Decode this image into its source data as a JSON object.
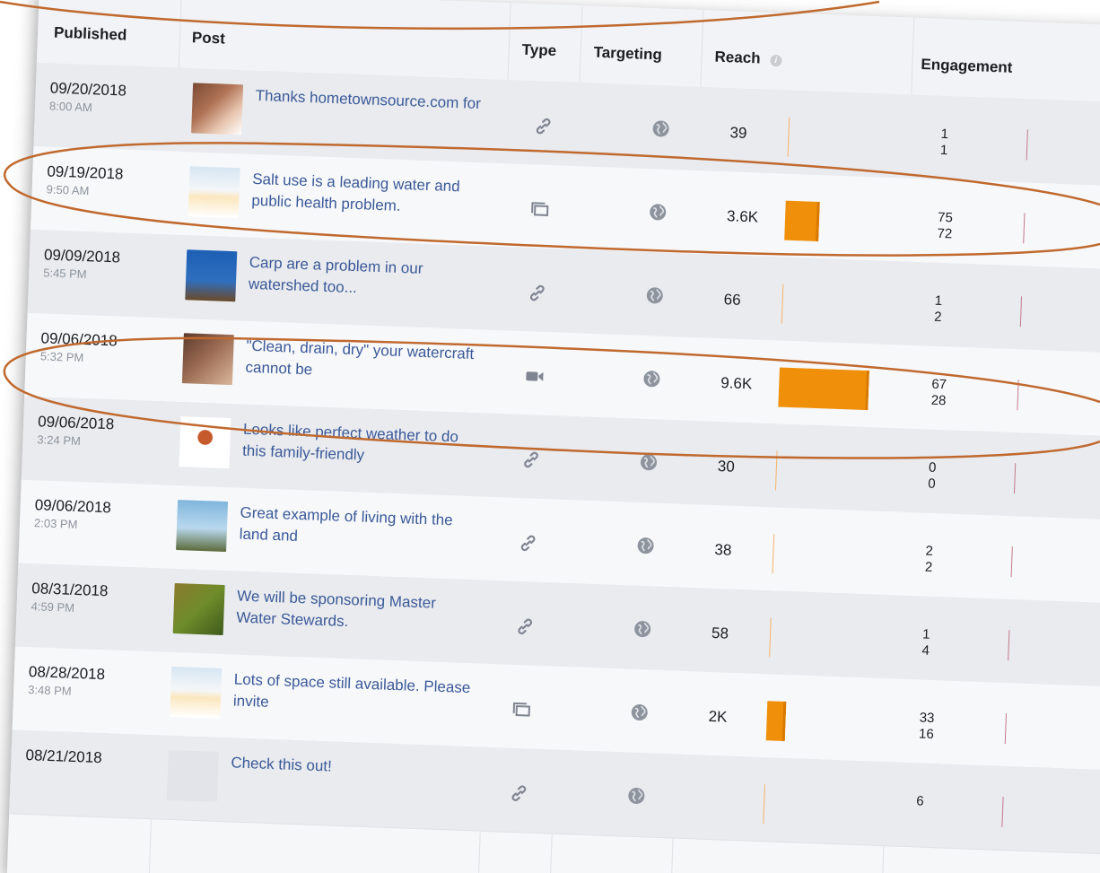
{
  "table": {
    "headers": {
      "published": "Published",
      "post": "Post",
      "type": "Type",
      "targeting": "Targeting",
      "reach": "Reach",
      "engagement": "Engagement"
    },
    "rows": [
      {
        "date": "09/20/2018",
        "time": "8:00 AM",
        "post": "Thanks hometownsource.com for",
        "type_icon": "link-icon",
        "reach": "39",
        "reach_fraction": 0.004,
        "eng1": "1",
        "eng2": "1",
        "thumb": "person"
      },
      {
        "date": "09/19/2018",
        "time": "9:50 AM",
        "post": "Salt use is a leading water and public health problem.",
        "type_icon": "album-icon",
        "reach": "3.6K",
        "reach_fraction": 0.375,
        "eng1": "75",
        "eng2": "72",
        "thumb": "doc"
      },
      {
        "date": "09/09/2018",
        "time": "5:45 PM",
        "post": "Carp are a problem in our watershed too...",
        "type_icon": "link-icon",
        "reach": "66",
        "reach_fraction": 0.007,
        "eng1": "1",
        "eng2": "2",
        "thumb": "water"
      },
      {
        "date": "09/06/2018",
        "time": "5:32 PM",
        "post": "\"Clean, drain, dry\" your watercraft cannot be",
        "type_icon": "video-icon",
        "reach": "9.6K",
        "reach_fraction": 1.0,
        "eng1": "67",
        "eng2": "28",
        "thumb": "hands"
      },
      {
        "date": "09/06/2018",
        "time": "3:24 PM",
        "post": "Looks like perfect weather to do this family-friendly",
        "type_icon": "link-icon",
        "reach": "30",
        "reach_fraction": 0.003,
        "eng1": "0",
        "eng2": "0",
        "thumb": "logo"
      },
      {
        "date": "09/06/2018",
        "time": "2:03 PM",
        "post": "Great example of living with the land and",
        "type_icon": "link-icon",
        "reach": "38",
        "reach_fraction": 0.004,
        "eng1": "2",
        "eng2": "2",
        "thumb": "sky"
      },
      {
        "date": "08/31/2018",
        "time": "4:59 PM",
        "post": "We will be sponsoring Master Water Stewards.",
        "type_icon": "link-icon",
        "reach": "58",
        "reach_fraction": 0.006,
        "eng1": "1",
        "eng2": "4",
        "thumb": "leaves"
      },
      {
        "date": "08/28/2018",
        "time": "3:48 PM",
        "post": "Lots of space still available. Please invite",
        "type_icon": "album-icon",
        "reach": "2K",
        "reach_fraction": 0.21,
        "eng1": "33",
        "eng2": "16",
        "thumb": "doc"
      },
      {
        "date": "08/21/2018",
        "time": "",
        "post": "Check this out!",
        "type_icon": "link-icon",
        "reach": "",
        "reach_fraction": 0.002,
        "eng1": "6",
        "eng2": "",
        "thumb": "blank"
      }
    ]
  },
  "colors": {
    "bar": "#f0900a",
    "link": "#3b5998",
    "annotation": "#c0692e"
  },
  "targeting_icon": "globe-icon"
}
